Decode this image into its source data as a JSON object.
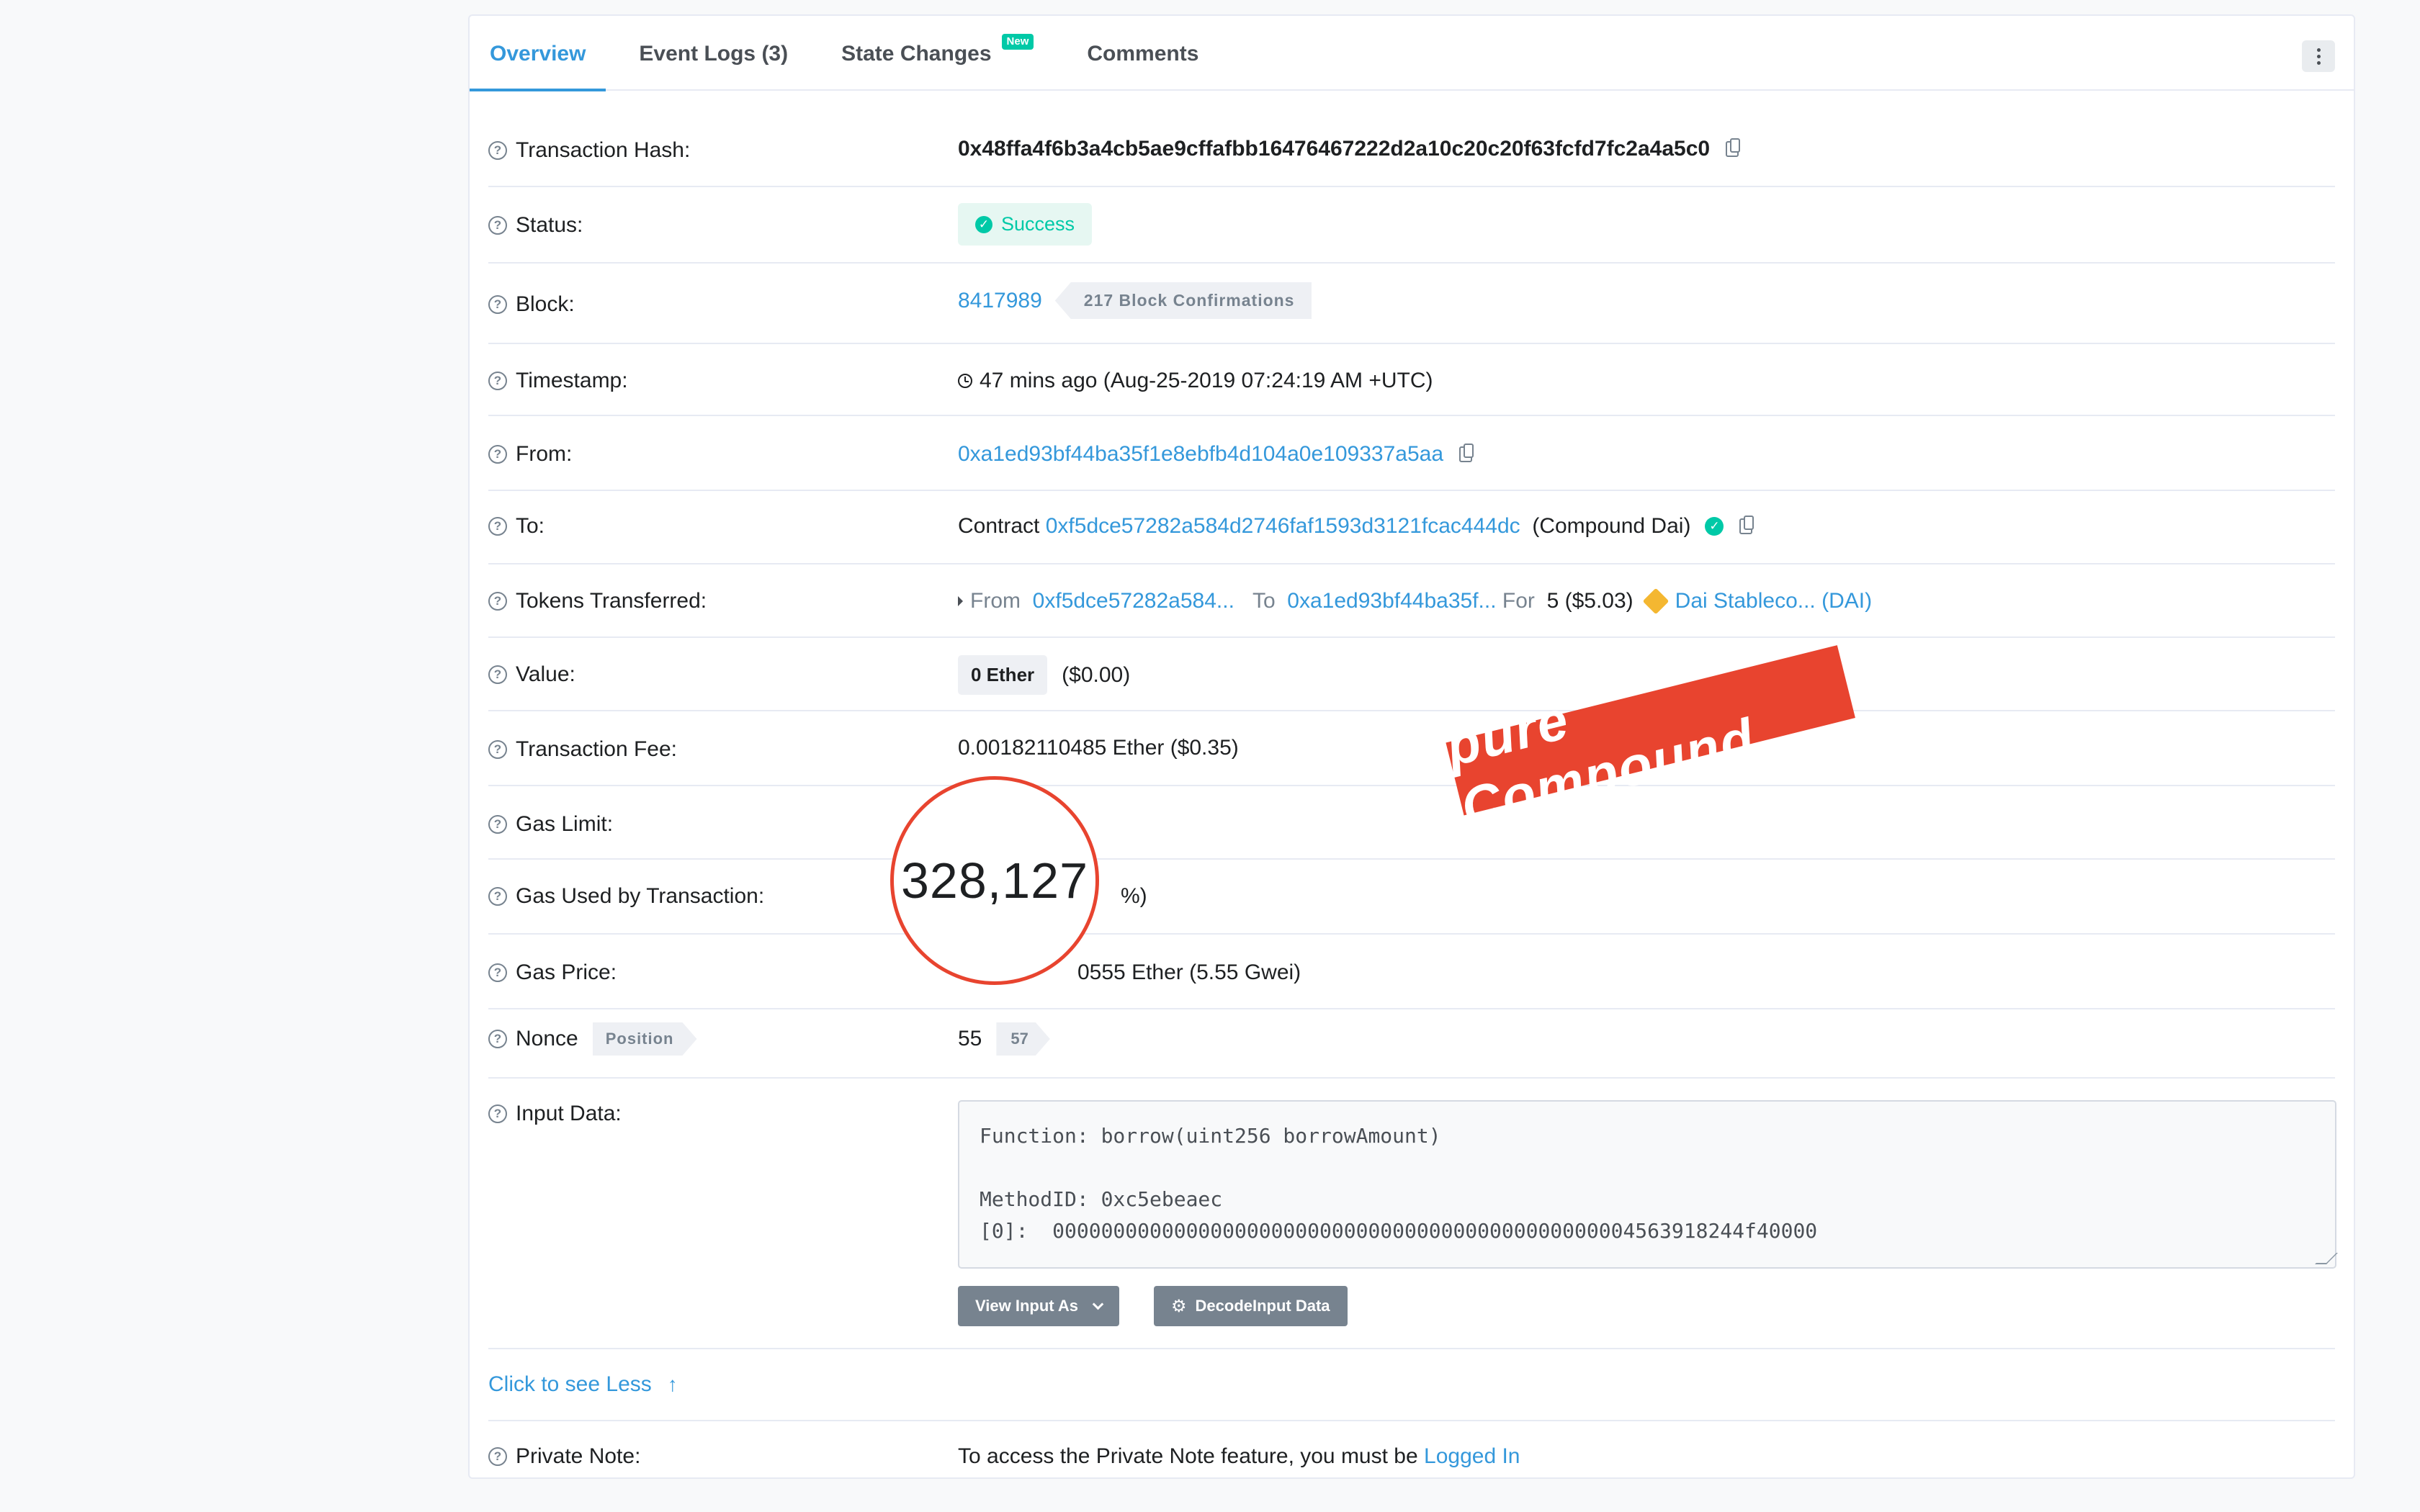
{
  "tabs": [
    {
      "label": "Overview"
    },
    {
      "label": "Event Logs (3)"
    },
    {
      "label": "State Changes",
      "badge": "New"
    },
    {
      "label": "Comments"
    }
  ],
  "rows": {
    "hash": {
      "label": "Transaction Hash:",
      "value": "0x48ffa4f6b3a4cb5ae9cffafbb16476467222d2a10c20c20f63fcfd7fc2a4a5c0"
    },
    "status": {
      "label": "Status:",
      "value": "Success"
    },
    "block": {
      "label": "Block:",
      "value": "8417989",
      "confirmations": "217 Block Confirmations"
    },
    "timestamp": {
      "label": "Timestamp:",
      "value": "47 mins ago (Aug-25-2019 07:24:19 AM +UTC)"
    },
    "from": {
      "label": "From:",
      "value": "0xa1ed93bf44ba35f1e8ebfb4d104a0e109337a5aa"
    },
    "to": {
      "label": "To:",
      "prefix": "Contract",
      "address": "0xf5dce57282a584d2746faf1593d3121fcac444dc",
      "name": "(Compound Dai)"
    },
    "tokens": {
      "label": "Tokens Transferred:",
      "from_label": "From",
      "from_addr": "0xf5dce57282a584...",
      "to_label": "To",
      "to_addr": "0xa1ed93bf44ba35f...",
      "for_label": "For",
      "amount": "5 ($5.03)",
      "token": "Dai Stableco... (DAI)"
    },
    "value": {
      "label": "Value:",
      "ether": "0 Ether",
      "usd": "($0.00)"
    },
    "fee": {
      "label": "Transaction Fee:",
      "value": "0.00182110485 Ether ($0.35)"
    },
    "gas_limit": {
      "label": "Gas Limit:"
    },
    "gas_used": {
      "label": "Gas Used by Transaction:",
      "suffix": "%)"
    },
    "gas_price": {
      "label": "Gas Price:",
      "value": "0555 Ether (5.55 Gwei)"
    },
    "nonce": {
      "label": "Nonce",
      "position_label": "Position",
      "value": "55",
      "position": "57"
    },
    "input": {
      "label": "Input Data:",
      "text": "Function: borrow(uint256 borrowAmount)\n\nMethodID: 0xc5ebeaec\n[0]:  000000000000000000000000000000000000000000000004563918244f40000",
      "view_btn": "View Input As",
      "decode_btn": "DecodeInput Data"
    },
    "less": {
      "label": "Click to see Less"
    },
    "note": {
      "label": "Private Note:",
      "text": "To access the Private Note feature, you must be",
      "link": "Logged In"
    }
  },
  "overlay": {
    "zoom_value": "328,127",
    "stamp_text": "pure Compound"
  },
  "colors": {
    "accent": "#3498db",
    "success": "#00c9a7",
    "stamp": "#e8442f"
  }
}
